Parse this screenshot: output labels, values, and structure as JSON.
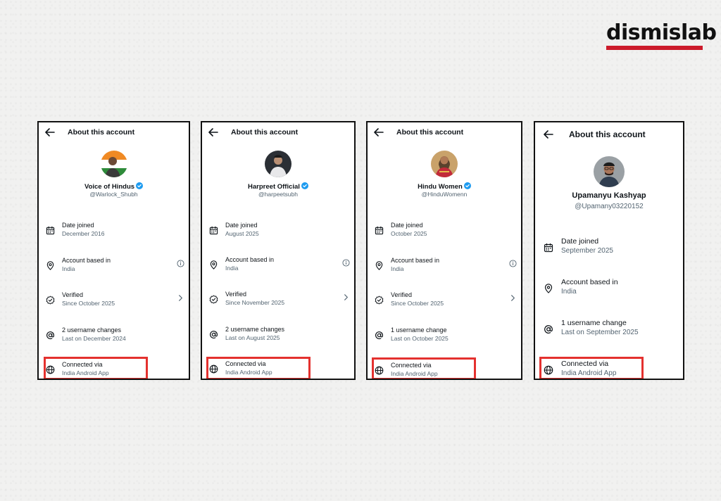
{
  "brand": {
    "logo_text": "dismislab",
    "bar_color": "#cc1b2b"
  },
  "colors": {
    "highlight": "#e4312f",
    "verified": "#1d9bf0",
    "muted": "#536471"
  },
  "cards": [
    {
      "header_title": "About this account",
      "display_name": "Voice of Hindus",
      "verified_badge": true,
      "handle": "@Warlock_Shubh",
      "rows": [
        {
          "icon": "calendar-icon",
          "title": "Date joined",
          "sub": "December 2016",
          "trailing": ""
        },
        {
          "icon": "location-pin-icon",
          "title": "Account based in",
          "sub": "India",
          "trailing": "info-icon"
        },
        {
          "icon": "verified-check-icon",
          "title": "Verified",
          "sub": "Since October 2025",
          "trailing": "chevron-right-icon"
        },
        {
          "icon": "at-sign-icon",
          "title": "2 username changes",
          "sub": "Last on December 2024",
          "trailing": ""
        },
        {
          "icon": "globe-icon",
          "title": "Connected via",
          "sub": "India Android App",
          "trailing": ""
        }
      ]
    },
    {
      "header_title": "About this account",
      "display_name": "Harpreet Official",
      "verified_badge": true,
      "handle": "@harpeetsubh",
      "rows": [
        {
          "icon": "calendar-icon",
          "title": "Date joined",
          "sub": "August 2025",
          "trailing": ""
        },
        {
          "icon": "location-pin-icon",
          "title": "Account based in",
          "sub": "India",
          "trailing": "info-icon"
        },
        {
          "icon": "verified-check-icon",
          "title": "Verified",
          "sub": "Since November 2025",
          "trailing": "chevron-right-icon"
        },
        {
          "icon": "at-sign-icon",
          "title": "2 username changes",
          "sub": "Last on August 2025",
          "trailing": ""
        },
        {
          "icon": "globe-icon",
          "title": "Connected via",
          "sub": "India Android App",
          "trailing": ""
        }
      ]
    },
    {
      "header_title": "About this account",
      "display_name": "Hindu Women",
      "verified_badge": true,
      "handle": "@HinduWomenn",
      "rows": [
        {
          "icon": "calendar-icon",
          "title": "Date joined",
          "sub": "October 2025",
          "trailing": ""
        },
        {
          "icon": "location-pin-icon",
          "title": "Account based in",
          "sub": "India",
          "trailing": "info-icon"
        },
        {
          "icon": "verified-check-icon",
          "title": "Verified",
          "sub": "Since October 2025",
          "trailing": "chevron-right-icon"
        },
        {
          "icon": "at-sign-icon",
          "title": "1 username change",
          "sub": "Last on October 2025",
          "trailing": ""
        },
        {
          "icon": "globe-icon",
          "title": "Connected via",
          "sub": "India Android App",
          "trailing": ""
        }
      ]
    },
    {
      "header_title": "About this account",
      "display_name": "Upamanyu Kashyap",
      "verified_badge": false,
      "handle": "@Upamany03220152",
      "rows": [
        {
          "icon": "calendar-icon",
          "title": "Date joined",
          "sub": "September 2025",
          "trailing": ""
        },
        {
          "icon": "location-pin-icon",
          "title": "Account based in",
          "sub": "India",
          "trailing": ""
        },
        {
          "icon": "at-sign-icon",
          "title": "1 username change",
          "sub": "Last on September 2025",
          "trailing": ""
        },
        {
          "icon": "globe-icon",
          "title": "Connected via",
          "sub": "India Android App",
          "trailing": ""
        }
      ]
    }
  ]
}
